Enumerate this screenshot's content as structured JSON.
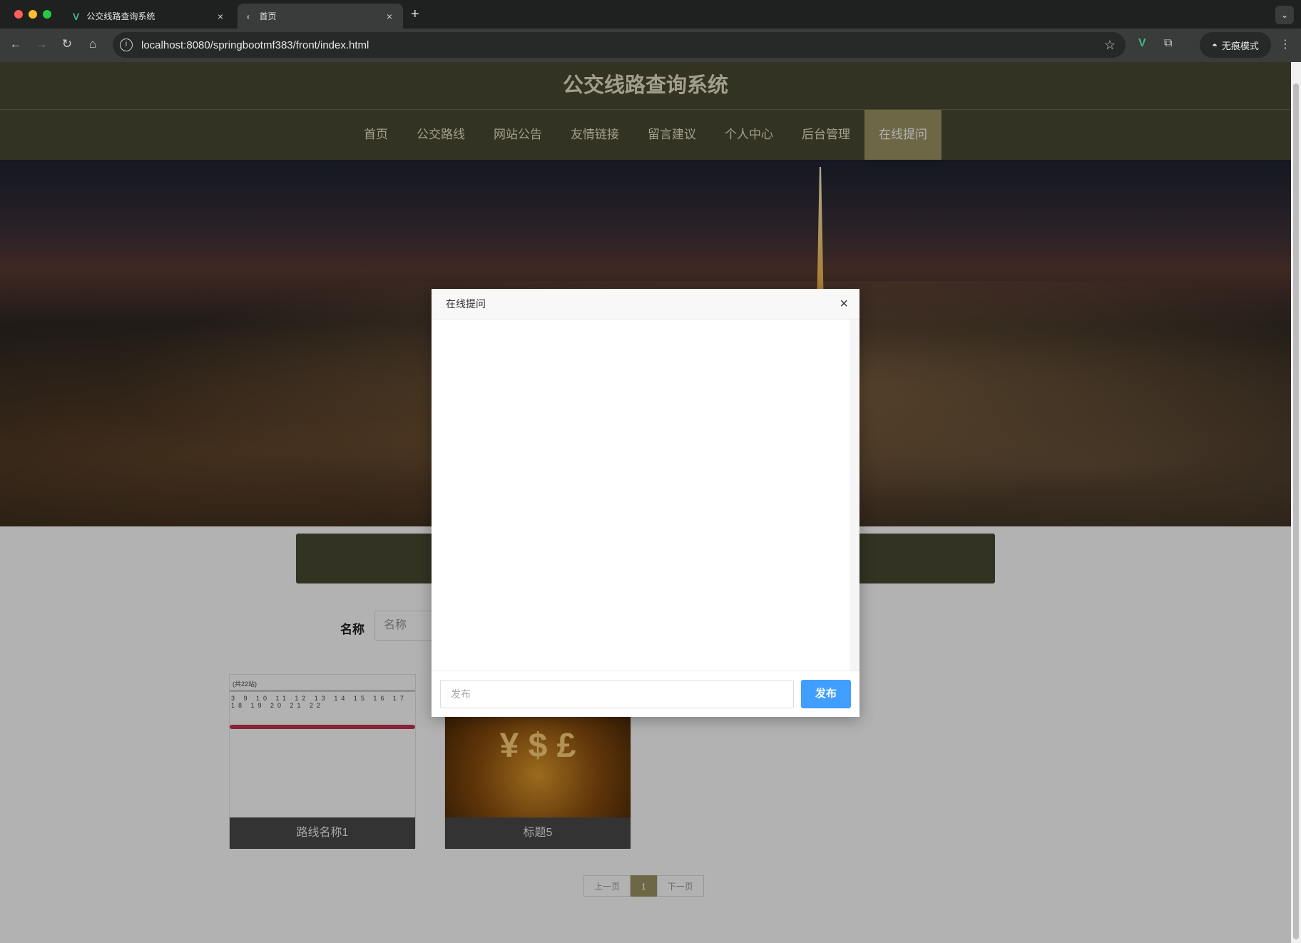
{
  "browser": {
    "tabs": [
      {
        "title": "公交线路查询系统",
        "icon": "V"
      },
      {
        "title": "首页",
        "icon": "◐"
      }
    ],
    "new_tab": "+",
    "url": "localhost:8080/springbootmf383/front/index.html",
    "incognito_label": "无痕模式"
  },
  "site": {
    "title": "公交线路查询系统",
    "nav": [
      "首页",
      "公交路线",
      "网站公告",
      "友情链接",
      "留言建议",
      "个人中心",
      "后台管理",
      "在线提问"
    ],
    "active_nav": "在线提问"
  },
  "search": {
    "label": "名称",
    "placeholder": "名称"
  },
  "cards": [
    {
      "caption": "路线名称1",
      "route_header": "(共22站)",
      "route_numbers": "3 9 10 11 12 13 14 15 16 17 18 19 20 21 22"
    },
    {
      "caption": "标题5",
      "symbols": "¥ $ £"
    }
  ],
  "pager": {
    "prev": "上一页",
    "current": "1",
    "next": "下一页"
  },
  "modal": {
    "title": "在线提问",
    "close": "×",
    "input_placeholder": "发布",
    "submit_label": "发布"
  },
  "colors": {
    "header_bg": "#4a4a33",
    "nav_active_bg": "#9c9464",
    "submit_btn": "#409eff"
  }
}
